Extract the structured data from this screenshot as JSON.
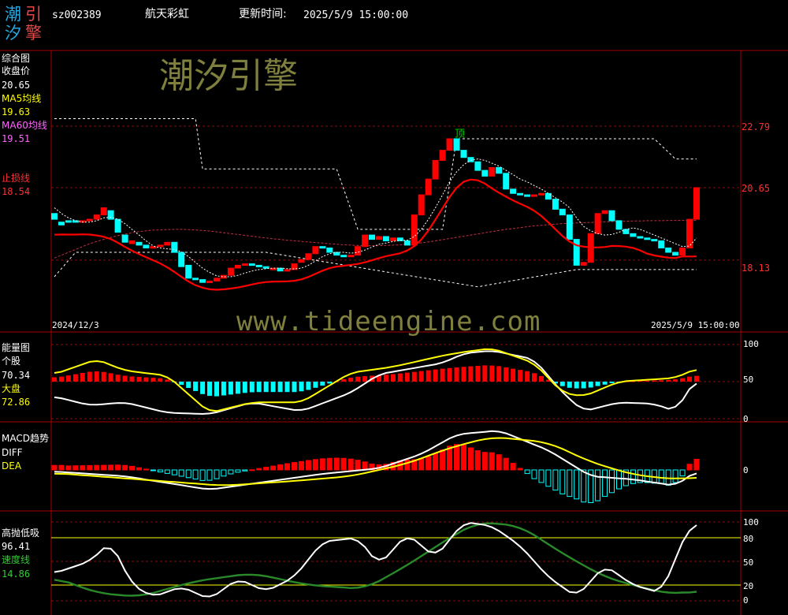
{
  "header": {
    "logo_chars": [
      "潮",
      "引",
      "汐",
      "擎"
    ],
    "stock_code": "sz002389",
    "stock_name": "航天彩虹",
    "update_label": "更新时间:",
    "update_time": "2025/5/9 15:00:00"
  },
  "watermarks": {
    "brand": "潮汐引擎",
    "url": "www.tideengine.com"
  },
  "colors": {
    "up": "#ff0000",
    "down": "#00ffff",
    "ma5": "#ffffff",
    "ma60": "#ff0000",
    "stop": "#ff0000",
    "yellow": "#ffff00",
    "green": "#00aa00",
    "grid": "#aa0000",
    "axis_label": "#ff3030"
  },
  "main_panel": {
    "title": "综合图",
    "close_label": "收盘价",
    "close_value": "20.65",
    "ma5_label": "MA5均线",
    "ma5_value": "19.63",
    "ma60_label": "MA60均线",
    "ma60_value": "19.51",
    "stop_label": "止损线",
    "stop_value": "18.54",
    "date_start": "2024/12/3",
    "date_end": "2025/5/9 15:00:00",
    "peak_label": "顶"
  },
  "energy_panel": {
    "title": "能量图",
    "stock_label": "个股",
    "stock_value": "70.34",
    "market_label": "大盘",
    "market_value": "72.86"
  },
  "macd_panel": {
    "title": "MACD趋势",
    "diff_label": "DIFF",
    "dea_label": "DEA"
  },
  "gaop_panel": {
    "title": "高抛低吸",
    "value": "96.41",
    "speed_label": "速度线",
    "speed_value": "14.86"
  },
  "chart_data": [
    {
      "type": "candlestick",
      "y_ticks": [
        "22.79",
        "20.65",
        "18.13"
      ],
      "y_tick_values": [
        22.79,
        20.65,
        18.13
      ],
      "ylim": [
        16.8,
        24.2
      ],
      "close": [
        19.55,
        19.35,
        19.45,
        19.45,
        19.5,
        19.55,
        19.7,
        19.95,
        19.55,
        19.1,
        18.75,
        18.8,
        18.65,
        18.55,
        18.6,
        18.65,
        18.75,
        18.4,
        17.9,
        17.5,
        17.45,
        17.35,
        17.4,
        17.5,
        17.6,
        17.85,
        17.95,
        18.0,
        17.95,
        17.9,
        17.85,
        17.85,
        17.75,
        17.8,
        18.0,
        18.15,
        18.35,
        18.6,
        18.55,
        18.4,
        18.3,
        18.25,
        18.3,
        18.6,
        19.0,
        18.85,
        18.95,
        18.8,
        18.9,
        18.8,
        18.65,
        19.7,
        20.4,
        20.95,
        21.6,
        21.95,
        22.35,
        21.95,
        21.7,
        21.55,
        21.25,
        21.05,
        21.35,
        21.15,
        20.6,
        20.45,
        20.4,
        20.35,
        20.4,
        20.45,
        20.25,
        19.9,
        19.7,
        18.85,
        17.95,
        18.05,
        19.05,
        19.75,
        19.85,
        19.5,
        19.2,
        19.05,
        18.95,
        18.9,
        18.85,
        18.8,
        18.55,
        18.4,
        18.3,
        18.55,
        19.55,
        20.65
      ],
      "open": [
        19.75,
        19.45,
        19.5,
        19.5,
        19.45,
        19.5,
        19.55,
        19.7,
        19.85,
        19.55,
        19.0,
        18.7,
        18.75,
        18.65,
        18.55,
        18.6,
        18.65,
        18.75,
        18.4,
        17.95,
        17.5,
        17.45,
        17.35,
        17.4,
        17.5,
        17.6,
        17.85,
        17.95,
        18.0,
        17.95,
        17.9,
        17.85,
        17.85,
        17.75,
        17.8,
        18.05,
        18.15,
        18.35,
        18.6,
        18.55,
        18.4,
        18.3,
        18.25,
        18.3,
        18.6,
        19.0,
        18.85,
        18.95,
        18.8,
        18.9,
        18.8,
        18.65,
        19.7,
        20.4,
        20.95,
        21.6,
        21.95,
        22.35,
        21.95,
        21.7,
        21.55,
        21.25,
        21.05,
        21.35,
        21.15,
        20.6,
        20.45,
        20.4,
        20.35,
        20.4,
        20.45,
        20.25,
        19.9,
        19.7,
        18.85,
        17.95,
        18.05,
        19.05,
        19.75,
        19.85,
        19.5,
        19.2,
        19.05,
        18.95,
        18.9,
        18.85,
        18.8,
        18.55,
        18.4,
        18.3,
        18.55,
        19.55
      ],
      "ma5": [
        19.95,
        19.75,
        19.6,
        19.5,
        19.45,
        19.45,
        19.5,
        19.6,
        19.62,
        19.55,
        19.4,
        19.2,
        19.0,
        18.8,
        18.62,
        18.55,
        18.52,
        18.5,
        18.42,
        18.25,
        18.05,
        17.85,
        17.7,
        17.58,
        17.55,
        17.55,
        17.6,
        17.68,
        17.75,
        17.8,
        17.83,
        17.85,
        17.85,
        17.83,
        17.82,
        17.85,
        17.95,
        18.1,
        18.25,
        18.35,
        18.4,
        18.4,
        18.37,
        18.4,
        18.48,
        18.58,
        18.68,
        18.72,
        18.78,
        18.82,
        18.82,
        18.95,
        19.2,
        19.55,
        19.95,
        20.4,
        20.85,
        21.2,
        21.45,
        21.6,
        21.65,
        21.6,
        21.5,
        21.4,
        21.25,
        21.1,
        20.95,
        20.85,
        20.72,
        20.6,
        20.45,
        20.3,
        20.15,
        19.95,
        19.6,
        19.3,
        19.15,
        19.05,
        19.0,
        19.02,
        19.1,
        19.2,
        19.25,
        19.2,
        19.1,
        19.0,
        18.9,
        18.8,
        18.7,
        18.6,
        18.62,
        18.9
      ],
      "ma60": [
        18.2,
        18.3,
        18.4,
        18.5,
        18.6,
        18.7,
        18.78,
        18.85,
        18.92,
        18.98,
        19.03,
        19.08,
        19.12,
        19.15,
        19.17,
        19.18,
        19.19,
        19.2,
        19.2,
        19.19,
        19.18,
        19.16,
        19.14,
        19.11,
        19.08,
        19.05,
        19.02,
        18.99,
        18.96,
        18.93,
        18.9,
        18.87,
        18.85,
        18.82,
        18.8,
        18.78,
        18.76,
        18.74,
        18.72,
        18.7,
        18.68,
        18.66,
        18.65,
        18.64,
        18.63,
        18.63,
        18.63,
        18.64,
        18.65,
        18.66,
        18.68,
        18.7,
        18.73,
        18.76,
        18.8,
        18.84,
        18.88,
        18.92,
        18.96,
        19.0,
        19.04,
        19.08,
        19.12,
        19.16,
        19.2,
        19.23,
        19.26,
        19.29,
        19.32,
        19.34,
        19.36,
        19.38,
        19.4,
        19.41,
        19.42,
        19.43,
        19.44,
        19.45,
        19.46,
        19.47,
        19.48,
        19.48,
        19.49,
        19.49,
        19.5,
        19.5,
        19.5,
        19.51,
        19.51,
        19.51,
        19.51,
        19.51
      ]
    },
    {
      "type": "line",
      "panel": "energy",
      "y_ticks": [
        "100",
        "50",
        "0"
      ],
      "ylim": [
        0,
        100
      ]
    },
    {
      "type": "line",
      "panel": "macd",
      "y_ticks": [
        "0"
      ]
    },
    {
      "type": "line",
      "panel": "gaop",
      "y_ticks": [
        "100",
        "80",
        "50",
        "20",
        "0"
      ],
      "ylim": [
        0,
        100
      ]
    }
  ]
}
